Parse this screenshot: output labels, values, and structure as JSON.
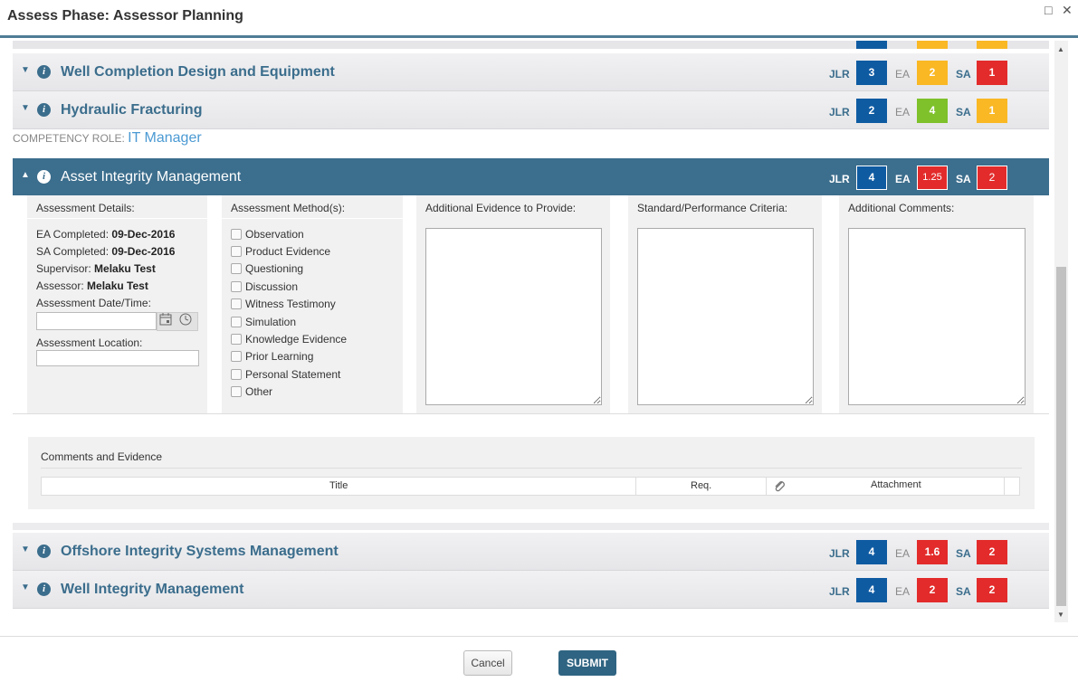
{
  "window": {
    "title": "Assess Phase: Assessor Planning",
    "maximize_glyph": "□",
    "close_glyph": "✕"
  },
  "labels": {
    "jlr": "JLR",
    "ea": "EA",
    "sa": "SA"
  },
  "top_sections": [
    {
      "title": "Well Completion Design and Equipment",
      "jlr": "3",
      "ea": "2",
      "sa": "1"
    },
    {
      "title": "Hydraulic Fracturing",
      "jlr": "2",
      "ea": "4",
      "sa": "1"
    }
  ],
  "role": {
    "label": "COMPETENCY ROLE:",
    "value": "IT Manager"
  },
  "active_section": {
    "title": "Asset Integrity Management",
    "jlr": "4",
    "ea": "1.25",
    "sa": "2"
  },
  "details": {
    "heading": "Assessment Details:",
    "ea_completed_label": "EA Completed:",
    "ea_completed_value": "09-Dec-2016",
    "sa_completed_label": "SA Completed:",
    "sa_completed_value": "09-Dec-2016",
    "supervisor_label": "Supervisor:",
    "supervisor_value": "Melaku Test",
    "assessor_label": "Assessor:",
    "assessor_value": "Melaku Test",
    "date_label": "Assessment Date/Time:",
    "location_label": "Assessment Location:",
    "date_value": "",
    "location_value": ""
  },
  "methods": {
    "heading": "Assessment Method(s):",
    "items": [
      "Observation",
      "Product Evidence",
      "Questioning",
      "Discussion",
      "Witness Testimony",
      "Simulation",
      "Knowledge Evidence",
      "Prior Learning",
      "Personal Statement",
      "Other"
    ]
  },
  "text_columns": {
    "evidence": "Additional Evidence to Provide:",
    "criteria": "Standard/Performance Criteria:",
    "comments": "Additional Comments:"
  },
  "comments_evidence": {
    "title": "Comments and Evidence",
    "columns": {
      "title": "Title",
      "req": "Req.",
      "attachment": "Attachment"
    }
  },
  "bottom_sections": [
    {
      "title": "Offshore Integrity Systems Management",
      "jlr": "4",
      "ea": "1.6",
      "sa": "2"
    },
    {
      "title": "Well Integrity Management",
      "jlr": "4",
      "ea": "2",
      "sa": "2"
    }
  ],
  "buttons": {
    "cancel": "Cancel",
    "submit": "SUBMIT"
  },
  "colors": {
    "header_blue": "#3c6e8d",
    "badge_blue": "#0f5ba2",
    "badge_orange": "#f9b824",
    "badge_green": "#7ec12a",
    "badge_red": "#e32b2b"
  }
}
